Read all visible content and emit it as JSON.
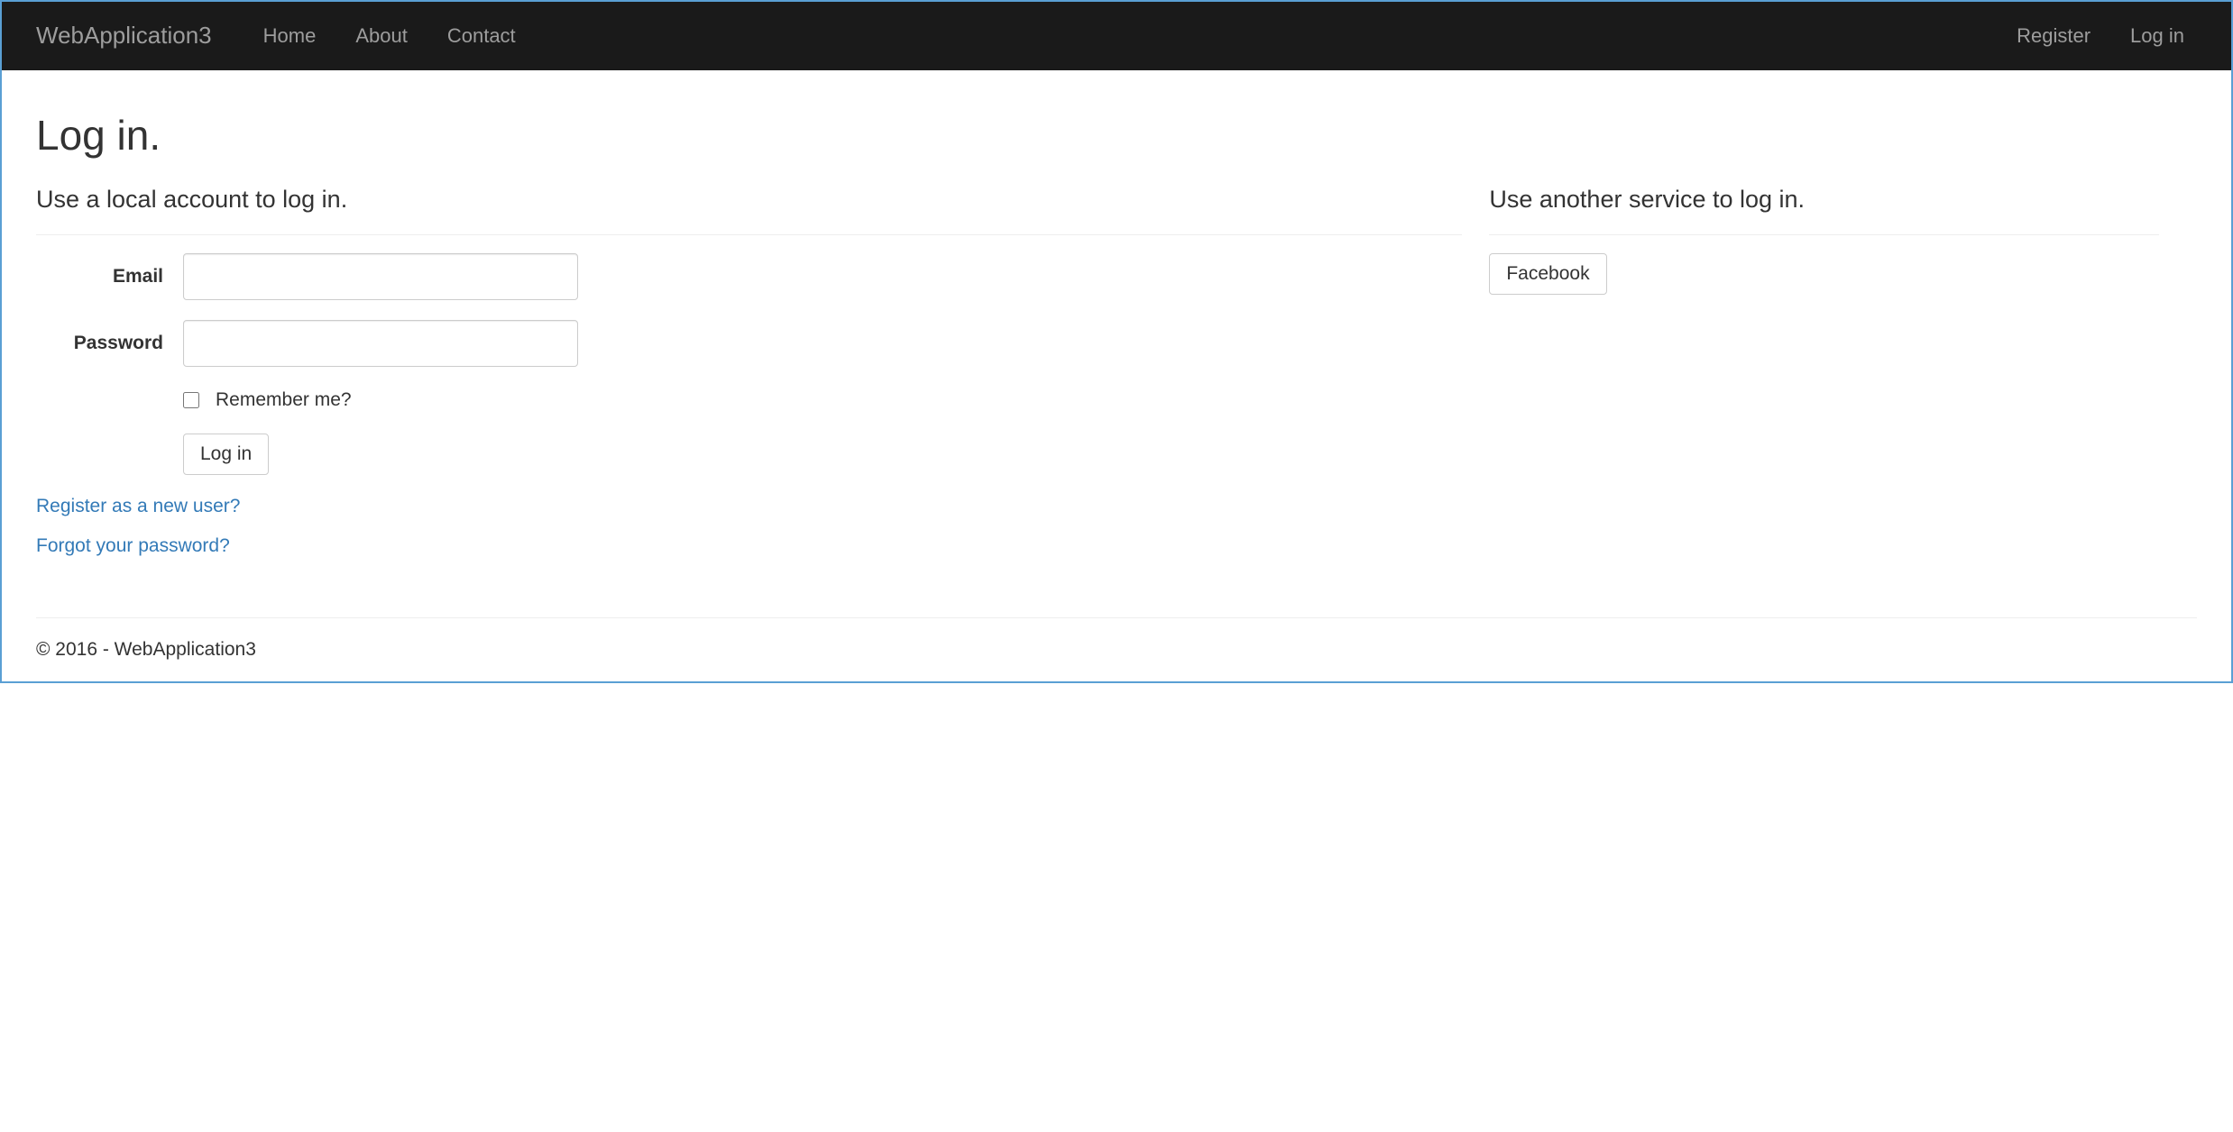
{
  "navbar": {
    "brand": "WebApplication3",
    "left_links": [
      "Home",
      "About",
      "Contact"
    ],
    "right_links": [
      "Register",
      "Log in"
    ]
  },
  "page": {
    "title": "Log in."
  },
  "local_login": {
    "heading": "Use a local account to log in.",
    "email_label": "Email",
    "password_label": "Password",
    "remember_label": "Remember me?",
    "submit_label": "Log in",
    "register_link": "Register as a new user?",
    "forgot_link": "Forgot your password?"
  },
  "external_login": {
    "heading": "Use another service to log in.",
    "providers": [
      "Facebook"
    ]
  },
  "footer": {
    "text": "© 2016 - WebApplication3"
  }
}
